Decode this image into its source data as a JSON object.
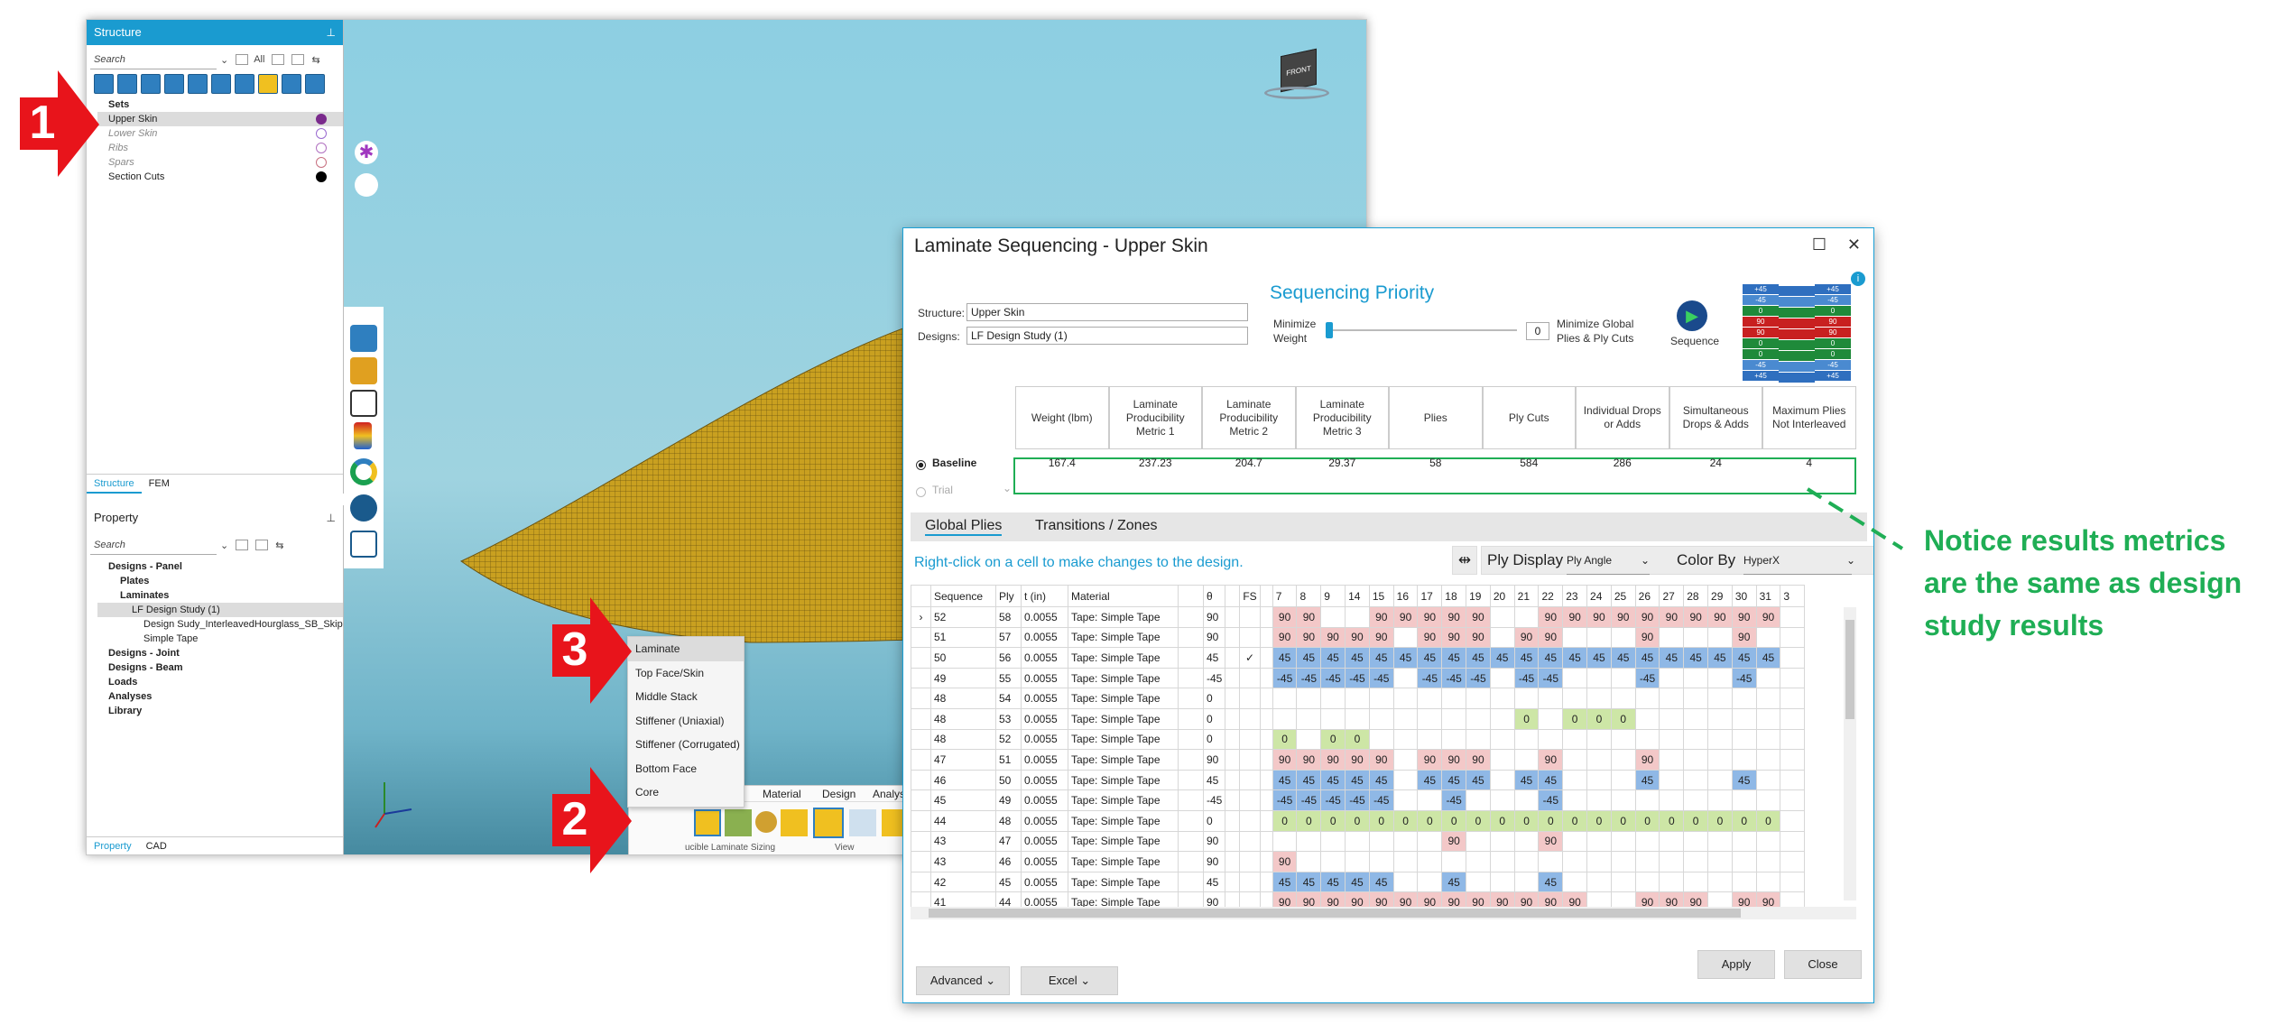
{
  "structure_panel": {
    "title": "Structure",
    "search_placeholder": "Search",
    "filter": "All",
    "tree": [
      {
        "label": "Sets",
        "bold": true
      },
      {
        "label": "Upper Skin",
        "selected": true,
        "dot": "#7a2a8c"
      },
      {
        "label": "Lower Skin",
        "dim": true,
        "dot": "#9a6ad0"
      },
      {
        "label": "Ribs",
        "dim": true,
        "dot": "#b070c0"
      },
      {
        "label": "Spars",
        "dim": true,
        "dot": "#c87080"
      },
      {
        "label": "Section Cuts",
        "dot": "#000000"
      }
    ],
    "tabs": [
      "Structure",
      "FEM"
    ]
  },
  "property_panel": {
    "title": "Property",
    "search_placeholder": "Search",
    "tree": [
      {
        "label": "Designs - Panel",
        "bold": true,
        "indent": 0
      },
      {
        "label": "Plates",
        "bold": true,
        "indent": 1
      },
      {
        "label": "Laminates",
        "bold": true,
        "indent": 1
      },
      {
        "label": "LF Design Study (1)",
        "indent": 2,
        "selected": true
      },
      {
        "label": "Design Sudy_InterleavedHourglass_SB_Skip",
        "indent": 3
      },
      {
        "label": "Simple Tape",
        "indent": 3
      },
      {
        "label": "Designs - Joint",
        "bold": true,
        "indent": 0
      },
      {
        "label": "Designs - Beam",
        "bold": true,
        "indent": 0
      },
      {
        "label": "Loads",
        "bold": true,
        "indent": 0
      },
      {
        "label": "Analyses",
        "bold": true,
        "indent": 0
      },
      {
        "label": "Library",
        "bold": true,
        "indent": 0
      }
    ],
    "tabs": [
      "Property",
      "CAD"
    ]
  },
  "ribbon": {
    "tabs": [
      "Material",
      "Design",
      "Analys"
    ],
    "partial_tab": "M",
    "group_labels": [
      "ucible Laminate Sizing",
      "View"
    ]
  },
  "context_menu": [
    "Laminate",
    "Top Face/Skin",
    "Middle Stack",
    "Stiffener (Uniaxial)",
    "Stiffener (Corrugated)",
    "Bottom Face",
    "Core"
  ],
  "dialog": {
    "title": "Laminate Sequencing - Upper Skin",
    "structure_label": "Structure:",
    "structure_value": "Upper Skin",
    "designs_label": "Designs:",
    "designs_value": "LF Design Study (1)",
    "priority_title": "Sequencing Priority",
    "min_weight": "Minimize Weight",
    "slider_value": "0",
    "min_global": "Minimize Global Plies & Ply Cuts",
    "sequence_btn": "Sequence",
    "stack_preview": [
      "+45",
      "-45",
      "0",
      "90",
      "90",
      "0",
      "0",
      "-45",
      "+45"
    ],
    "metric_headers": [
      "Weight (lbm)",
      "Laminate Producibility Metric 1",
      "Laminate Producibility Metric 2",
      "Laminate Producibility Metric 3",
      "Plies",
      "Ply Cuts",
      "Individual Drops or Adds",
      "Simultaneous Drops & Adds",
      "Maximum Plies Not Interleaved"
    ],
    "baseline_label": "Baseline",
    "trial_label": "Trial",
    "baseline_values": [
      "167.4",
      "237.23",
      "204.7",
      "29.37",
      "58",
      "584",
      "286",
      "24",
      "4"
    ],
    "tabs": [
      "Global Plies",
      "Transitions / Zones"
    ],
    "hint": "Right-click on a cell to make changes to the design.",
    "ply_display_label": "Ply Display",
    "ply_display_value": "Ply Angle",
    "color_by_label": "Color By",
    "color_by_value": "HyperX",
    "columns": [
      "Sequence",
      "Ply",
      "t (in)",
      "Material",
      "θ",
      "FS"
    ],
    "zone_columns": [
      "7",
      "8",
      "9",
      "14",
      "15",
      "16",
      "17",
      "18",
      "19",
      "20",
      "21",
      "22",
      "23",
      "24",
      "25",
      "26",
      "27",
      "28",
      "29",
      "30",
      "31",
      "3"
    ],
    "rows": [
      {
        "seq": "52",
        "ply": "58",
        "t": "0.0055",
        "mat": "Tape: Simple Tape",
        "theta": "90",
        "fs": "",
        "cells": [
          "90",
          "90",
          "",
          "",
          "90",
          "90",
          "90",
          "90",
          "90",
          "",
          "",
          "90",
          "90",
          "90",
          "90",
          "90",
          "90",
          "90",
          "90",
          "90",
          "90",
          ""
        ]
      },
      {
        "seq": "51",
        "ply": "57",
        "t": "0.0055",
        "mat": "Tape: Simple Tape",
        "theta": "90",
        "fs": "",
        "cells": [
          "90",
          "90",
          "90",
          "90",
          "90",
          "",
          "90",
          "90",
          "90",
          "",
          "90",
          "90",
          "",
          "",
          "",
          "90",
          "",
          "",
          "",
          "90",
          "",
          ""
        ]
      },
      {
        "seq": "50",
        "ply": "56",
        "t": "0.0055",
        "mat": "Tape: Simple Tape",
        "theta": "45",
        "fs": "✓",
        "cells": [
          "45",
          "45",
          "45",
          "45",
          "45",
          "45",
          "45",
          "45",
          "45",
          "45",
          "45",
          "45",
          "45",
          "45",
          "45",
          "45",
          "45",
          "45",
          "45",
          "45",
          "45",
          ""
        ]
      },
      {
        "seq": "49",
        "ply": "55",
        "t": "0.0055",
        "mat": "Tape: Simple Tape",
        "theta": "-45",
        "fs": "",
        "cells": [
          "-45",
          "-45",
          "-45",
          "-45",
          "-45",
          "",
          "-45",
          "-45",
          "-45",
          "",
          "-45",
          "-45",
          "",
          "",
          "",
          "-45",
          "",
          "",
          "",
          "-45",
          "",
          ""
        ]
      },
      {
        "seq": "48",
        "ply": "54",
        "t": "0.0055",
        "mat": "Tape: Simple Tape",
        "theta": "0",
        "fs": "",
        "cells": [
          "",
          "",
          "",
          "",
          "",
          "",
          "",
          "",
          "",
          "",
          "",
          "",
          "",
          "",
          "",
          "",
          "",
          "",
          "",
          "",
          "",
          ""
        ]
      },
      {
        "seq": "48",
        "ply": "53",
        "t": "0.0055",
        "mat": "Tape: Simple Tape",
        "theta": "0",
        "fs": "",
        "cells": [
          "",
          "",
          "",
          "",
          "",
          "",
          "",
          "",
          "",
          "",
          "0",
          "",
          "0",
          "0",
          "0",
          "",
          "",
          "",
          "",
          "",
          "",
          ""
        ]
      },
      {
        "seq": "48",
        "ply": "52",
        "t": "0.0055",
        "mat": "Tape: Simple Tape",
        "theta": "0",
        "fs": "",
        "cells": [
          "0",
          "",
          "0",
          "0",
          "",
          "",
          "",
          "",
          "",
          "",
          "",
          "",
          "",
          "",
          "",
          "",
          "",
          "",
          "",
          "",
          "",
          ""
        ]
      },
      {
        "seq": "47",
        "ply": "51",
        "t": "0.0055",
        "mat": "Tape: Simple Tape",
        "theta": "90",
        "fs": "",
        "cells": [
          "90",
          "90",
          "90",
          "90",
          "90",
          "",
          "90",
          "90",
          "90",
          "",
          "",
          "90",
          "",
          "",
          "",
          "90",
          "",
          "",
          "",
          "",
          "",
          ""
        ]
      },
      {
        "seq": "46",
        "ply": "50",
        "t": "0.0055",
        "mat": "Tape: Simple Tape",
        "theta": "45",
        "fs": "",
        "cells": [
          "45",
          "45",
          "45",
          "45",
          "45",
          "",
          "45",
          "45",
          "45",
          "",
          "45",
          "45",
          "",
          "",
          "",
          "45",
          "",
          "",
          "",
          "45",
          "",
          ""
        ]
      },
      {
        "seq": "45",
        "ply": "49",
        "t": "0.0055",
        "mat": "Tape: Simple Tape",
        "theta": "-45",
        "fs": "",
        "cells": [
          "-45",
          "-45",
          "-45",
          "-45",
          "-45",
          "",
          "",
          "-45",
          "",
          "",
          "",
          "-45",
          "",
          "",
          "",
          "",
          "",
          "",
          "",
          "",
          "",
          ""
        ]
      },
      {
        "seq": "44",
        "ply": "48",
        "t": "0.0055",
        "mat": "Tape: Simple Tape",
        "theta": "0",
        "fs": "",
        "cells": [
          "0",
          "0",
          "0",
          "0",
          "0",
          "0",
          "0",
          "0",
          "0",
          "0",
          "0",
          "0",
          "0",
          "0",
          "0",
          "0",
          "0",
          "0",
          "0",
          "0",
          "0",
          ""
        ]
      },
      {
        "seq": "43",
        "ply": "47",
        "t": "0.0055",
        "mat": "Tape: Simple Tape",
        "theta": "90",
        "fs": "",
        "cells": [
          "",
          "",
          "",
          "",
          "",
          "",
          "",
          "90",
          "",
          "",
          "",
          "90",
          "",
          "",
          "",
          "",
          "",
          "",
          "",
          "",
          "",
          ""
        ]
      },
      {
        "seq": "43",
        "ply": "46",
        "t": "0.0055",
        "mat": "Tape: Simple Tape",
        "theta": "90",
        "fs": "",
        "cells": [
          "90",
          "",
          "",
          "",
          "",
          "",
          "",
          "",
          "",
          "",
          "",
          "",
          "",
          "",
          "",
          "",
          "",
          "",
          "",
          "",
          "",
          ""
        ]
      },
      {
        "seq": "42",
        "ply": "45",
        "t": "0.0055",
        "mat": "Tape: Simple Tape",
        "theta": "45",
        "fs": "",
        "cells": [
          "45",
          "45",
          "45",
          "45",
          "45",
          "",
          "",
          "45",
          "",
          "",
          "",
          "45",
          "",
          "",
          "",
          "",
          "",
          "",
          "",
          "",
          "",
          ""
        ]
      },
      {
        "seq": "41",
        "ply": "44",
        "t": "0.0055",
        "mat": "Tape: Simple Tape",
        "theta": "90",
        "fs": "",
        "cells": [
          "90",
          "90",
          "90",
          "90",
          "90",
          "90",
          "90",
          "90",
          "90",
          "90",
          "90",
          "90",
          "90",
          "",
          "",
          "90",
          "90",
          "90",
          "",
          "90",
          "90",
          ""
        ]
      }
    ],
    "advanced_btn": "Advanced",
    "excel_btn": "Excel",
    "apply_btn": "Apply",
    "close_btn": "Close"
  },
  "annotations": {
    "callouts": [
      "1",
      "2",
      "3"
    ],
    "note": "Notice results metrics are the same as design study results",
    "note_color": "#1fae55",
    "callout_color": "#e8141b"
  },
  "icons": [
    "pin-icon",
    "search-icon",
    "view-cube-icon",
    "sequence-play-icon",
    "info-icon",
    "axis-triad-icon"
  ]
}
